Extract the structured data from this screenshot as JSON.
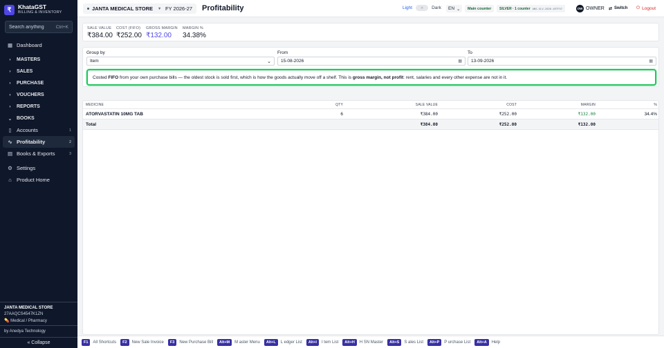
{
  "brand": {
    "logo": "₹",
    "name": "KhataGST",
    "subtitle": "BILLING & INVENTORY"
  },
  "search": {
    "placeholder": "Search anything",
    "shortcut": "Ctrl+K"
  },
  "sidebar": {
    "dashboard": "Dashboard",
    "masters": "MASTERS",
    "sales": "SALES",
    "purchase": "PURCHASE",
    "vouchers": "VOUCHERS",
    "reports": "REPORTS",
    "books": "BOOKS",
    "accounts": "Accounts",
    "accounts_count": "1",
    "profitability": "Profitability",
    "profitability_count": "2",
    "books_exports": "Books & Exports",
    "books_exports_count": "3",
    "settings": "Settings",
    "product_home": "Product Home",
    "icons": [
      "grid-icon",
      "chevron-right-icon",
      "pulse-icon",
      "file-icon",
      "gear-icon",
      "home-icon"
    ]
  },
  "store": {
    "name": "JANTA MEDICAL STORE",
    "gstin": "27AAQCS4547K1ZN",
    "type": "Medical / Pharmacy"
  },
  "footer": {
    "by": "by Anedya Technology",
    "collapse": "« Collapse"
  },
  "topbar": {
    "store": "JANTA MEDICAL STORE",
    "fy": "FY 2026-27",
    "title": "Profitability",
    "light": "Light",
    "dark": "Dark",
    "lang": "EN",
    "main_counter": "Main counter",
    "license": "SILVER · 1 counter",
    "license_key": "ANS-SLV-2026-4ETF57",
    "owner_initials": "OW",
    "owner": "OWNER",
    "switch": "Switch",
    "logout": "Logout"
  },
  "stats": [
    {
      "label": "SALE VALUE",
      "value": "₹384.00"
    },
    {
      "label": "COST (FIFO)",
      "value": "₹252.00"
    },
    {
      "label": "GROSS MARGIN",
      "value": "₹132.00"
    },
    {
      "label": "MARGIN %",
      "value": "34.38%"
    }
  ],
  "filters": {
    "group_by_label": "Group by",
    "group_by_value": "Item",
    "from_label": "From",
    "from_value": "15-08-2026",
    "to_label": "To",
    "to_value": "13-09-2026"
  },
  "notice": {
    "t1": "Costed ",
    "b1": "FIFO",
    "t2": " from your own purchase bills — the oldest stock is sold first, which is how the goods actually move off a shelf. This is ",
    "b2": "gross margin, not profit",
    "t3": ": rent, salaries and every other expense are not in it."
  },
  "table": {
    "headers": [
      "MEDICINE",
      "QTY",
      "SALE VALUE",
      "COST",
      "MARGIN",
      "%"
    ],
    "rows": [
      {
        "medicine": "ATORVASTATIN 10MG TAB",
        "qty": "6",
        "sale": "₹384.00",
        "cost": "₹252.00",
        "margin": "₹132.00",
        "pct": "34.4%"
      }
    ],
    "total": {
      "label": "Total",
      "sale": "₹384.00",
      "cost": "₹252.00",
      "margin": "₹132.00"
    }
  },
  "shortcuts": [
    {
      "key": "F1",
      "label": "All Shortcuts"
    },
    {
      "key": "F2",
      "label": "New Sale Invoice"
    },
    {
      "key": "F3",
      "label": "New Purchase Bill"
    },
    {
      "key": "Alt+M",
      "label": "M aster Menu"
    },
    {
      "key": "Alt+L",
      "label": "L edger List"
    },
    {
      "key": "Alt+I",
      "label": "I tem List"
    },
    {
      "key": "Alt+H",
      "label": "H SN Master"
    },
    {
      "key": "Alt+S",
      "label": "S ales List"
    },
    {
      "key": "Alt+P",
      "label": "P urchase List"
    },
    {
      "key": "Alt+A",
      "label": "Help"
    }
  ]
}
